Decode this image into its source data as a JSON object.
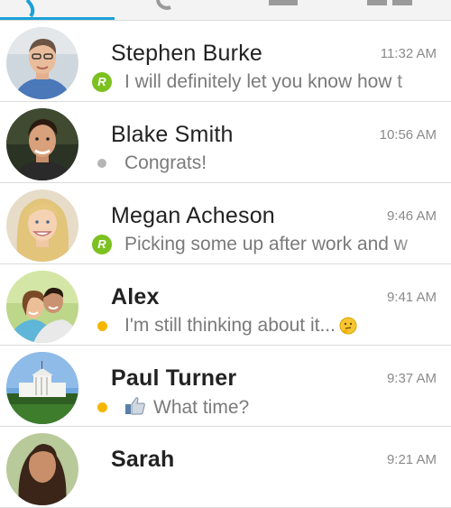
{
  "tabs": {
    "items": [
      {
        "icon": "chat-icon"
      },
      {
        "icon": "history-icon"
      },
      {
        "icon": "contacts-icon"
      },
      {
        "icon": "groups-icon"
      }
    ],
    "active_index": 0,
    "accent_color": "#1aa1d8"
  },
  "conversations": [
    {
      "name": "Stephen Burke",
      "time": "11:32 AM",
      "status": "read-receipt",
      "status_label": "R",
      "preview": "I will definitely let you know how t",
      "unread": false
    },
    {
      "name": "Blake Smith",
      "time": "10:56 AM",
      "status": "delivered",
      "preview": "Congrats!",
      "unread": false
    },
    {
      "name": "Megan Acheson",
      "time": "9:46 AM",
      "status": "read-receipt",
      "status_label": "R",
      "preview": "Picking some up after work and w",
      "unread": false
    },
    {
      "name": "Alex",
      "time": "9:41 AM",
      "status": "unread",
      "preview": "I'm still thinking about it...",
      "preview_icon": "thinking-emoji-icon",
      "unread": true
    },
    {
      "name": "Paul Turner",
      "time": "9:37 AM",
      "status": "unread",
      "preview": "What time?",
      "preview_icon": "thumbs-up-icon",
      "unread": true
    },
    {
      "name": "Sarah",
      "time": "9:21 AM",
      "status": "none",
      "preview": "",
      "unread": true
    }
  ],
  "colors": {
    "read_receipt": "#7cc11f",
    "unread_dot": "#f4b600",
    "delivered_dot": "#b5b5b5"
  }
}
